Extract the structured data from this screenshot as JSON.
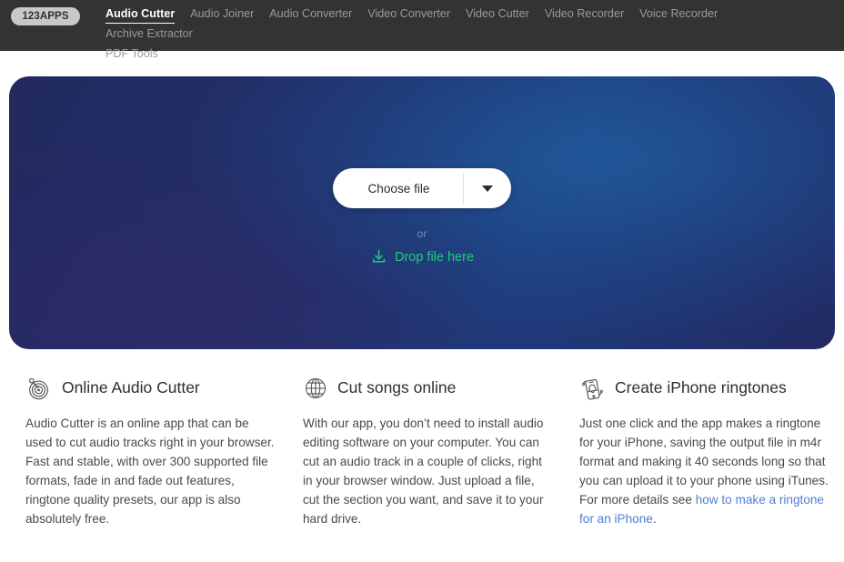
{
  "header": {
    "logo_text": "123APPS",
    "nav": [
      {
        "label": "Audio Cutter",
        "active": true
      },
      {
        "label": "Audio Joiner",
        "active": false
      },
      {
        "label": "Audio Converter",
        "active": false
      },
      {
        "label": "Video Converter",
        "active": false
      },
      {
        "label": "Video Cutter",
        "active": false
      },
      {
        "label": "Video Recorder",
        "active": false
      },
      {
        "label": "Voice Recorder",
        "active": false
      },
      {
        "label": "Archive Extractor",
        "active": false
      },
      {
        "label": "PDF Tools",
        "active": false
      }
    ]
  },
  "hero": {
    "choose_file_label": "Choose file",
    "dropdown_icon": "chevron-down-icon",
    "or_label": "or",
    "drop_file_label": "Drop file here",
    "drop_file_icon": "download-icon",
    "accent_green": "#1ecb7b",
    "background_colors": [
      "#222a5e",
      "#22306c",
      "#1f3c7e",
      "#232a63"
    ]
  },
  "features": [
    {
      "icon": "vinyl-record-icon",
      "title": "Online Audio Cutter",
      "body": "Audio Cutter is an online app that can be used to cut audio tracks right in your browser. Fast and stable, with over 300 supported file formats, fade in and fade out features, ringtone quality presets, our app is also absolutely free."
    },
    {
      "icon": "globe-icon",
      "title": "Cut songs online",
      "body": "With our app, you don’t need to install audio editing software on your computer. You can cut an audio track in a couple of clicks, right in your browser window. Just upload a file, cut the section you want, and save it to your hard drive."
    },
    {
      "icon": "phone-ringing-icon",
      "title": "Create iPhone ringtones",
      "body_before_link": "Just one click and the app makes a ringtone for your iPhone, saving the output file in m4r format and making it 40 seconds long so that you can upload it to your phone using iTunes. For more details see ",
      "link_text": "how to make a ringtone for an iPhone",
      "body_after_link": ".",
      "link_color": "#4f7fd0"
    }
  ]
}
